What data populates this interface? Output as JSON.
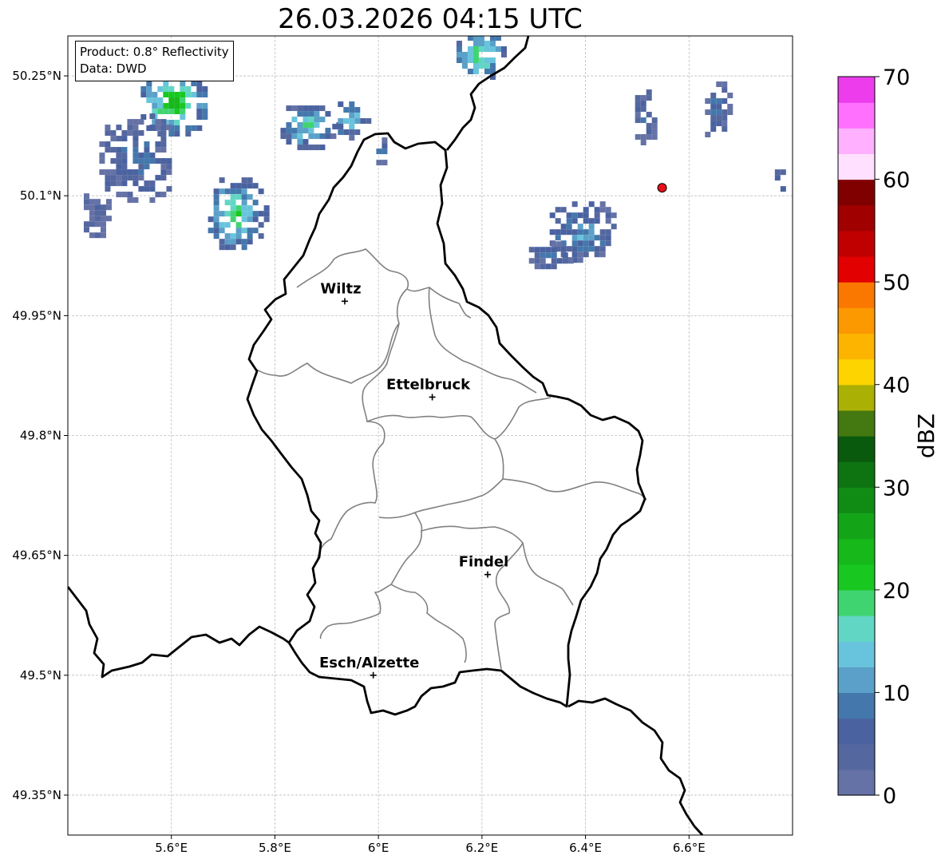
{
  "title": "26.03.2026 04:15 UTC",
  "info": {
    "product": "Product: 0.8° Reflectivity",
    "source": "Data: DWD"
  },
  "axes": {
    "lon_ticks": [
      {
        "value": 5.6,
        "label": "5.6°E"
      },
      {
        "value": 5.8,
        "label": "5.8°E"
      },
      {
        "value": 6.0,
        "label": "6°E"
      },
      {
        "value": 6.2,
        "label": "6.2°E"
      },
      {
        "value": 6.4,
        "label": "6.4°E"
      },
      {
        "value": 6.6,
        "label": "6.6°E"
      }
    ],
    "lat_ticks": [
      {
        "value": 50.25,
        "label": "50.25°N"
      },
      {
        "value": 50.1,
        "label": "50.1°N"
      },
      {
        "value": 49.95,
        "label": "49.95°N"
      },
      {
        "value": 49.8,
        "label": "49.8°N"
      },
      {
        "value": 49.65,
        "label": "49.65°N"
      },
      {
        "value": 49.5,
        "label": "49.5°N"
      },
      {
        "value": 49.35,
        "label": "49.35°N"
      }
    ],
    "lon_range": [
      5.4,
      6.8
    ],
    "lat_range": [
      49.3,
      50.3
    ],
    "grid": true
  },
  "cities": [
    {
      "name": "Wiltz",
      "lon": 5.935,
      "lat": 49.968
    },
    {
      "name": "Ettelbruck",
      "lon": 6.104,
      "lat": 49.848
    },
    {
      "name": "Findel",
      "lon": 6.211,
      "lat": 49.626
    },
    {
      "name": "Esch/Alzette",
      "lon": 5.99,
      "lat": 49.5
    }
  ],
  "radar_site": {
    "lon": 6.548,
    "lat": 50.11,
    "color": "#e8101a"
  },
  "colorbar": {
    "label": "dBZ",
    "min": 0,
    "max": 70,
    "tick_labels": [
      "0",
      "10",
      "20",
      "30",
      "40",
      "50",
      "60",
      "70"
    ],
    "colors": [
      "#6572a6",
      "#55679f",
      "#4a62a0",
      "#4478ac",
      "#5aa0c8",
      "#68c4dc",
      "#62d6c4",
      "#40d470",
      "#18c820",
      "#16b81a",
      "#14a418",
      "#108c14",
      "#0e7412",
      "#0a5a0e",
      "#447810",
      "#aab004",
      "#fed400",
      "#fcb400",
      "#fc9800",
      "#fa7800",
      "#e20000",
      "#c00000",
      "#a00000",
      "#800000",
      "#ffe0ff",
      "#ffb0ff",
      "#ff70ff",
      "#ec3cec"
    ]
  },
  "echoes": [
    {
      "lon": 5.6,
      "lat": 50.22,
      "rx": 0.07,
      "ry": 0.045,
      "dbz": 25
    },
    {
      "lon": 5.53,
      "lat": 50.15,
      "rx": 0.08,
      "ry": 0.06,
      "dbz": 8
    },
    {
      "lon": 5.72,
      "lat": 50.08,
      "rx": 0.06,
      "ry": 0.05,
      "dbz": 20
    },
    {
      "lon": 5.86,
      "lat": 50.19,
      "rx": 0.06,
      "ry": 0.03,
      "dbz": 18
    },
    {
      "lon": 5.94,
      "lat": 50.2,
      "rx": 0.04,
      "ry": 0.025,
      "dbz": 16
    },
    {
      "lon": 6.19,
      "lat": 50.28,
      "rx": 0.05,
      "ry": 0.035,
      "dbz": 22
    },
    {
      "lon": 6.39,
      "lat": 50.06,
      "rx": 0.07,
      "ry": 0.04,
      "dbz": 12
    },
    {
      "lon": 6.33,
      "lat": 50.03,
      "rx": 0.05,
      "ry": 0.02,
      "dbz": 8
    },
    {
      "lon": 6.51,
      "lat": 50.2,
      "rx": 0.025,
      "ry": 0.04,
      "dbz": 6
    },
    {
      "lon": 6.65,
      "lat": 50.21,
      "rx": 0.03,
      "ry": 0.04,
      "dbz": 8
    },
    {
      "lon": 6.77,
      "lat": 50.12,
      "rx": 0.015,
      "ry": 0.02,
      "dbz": 12
    },
    {
      "lon": 5.45,
      "lat": 50.08,
      "rx": 0.03,
      "ry": 0.03,
      "dbz": 5
    },
    {
      "lon": 6.0,
      "lat": 50.16,
      "rx": 0.015,
      "ry": 0.02,
      "dbz": 12
    }
  ]
}
